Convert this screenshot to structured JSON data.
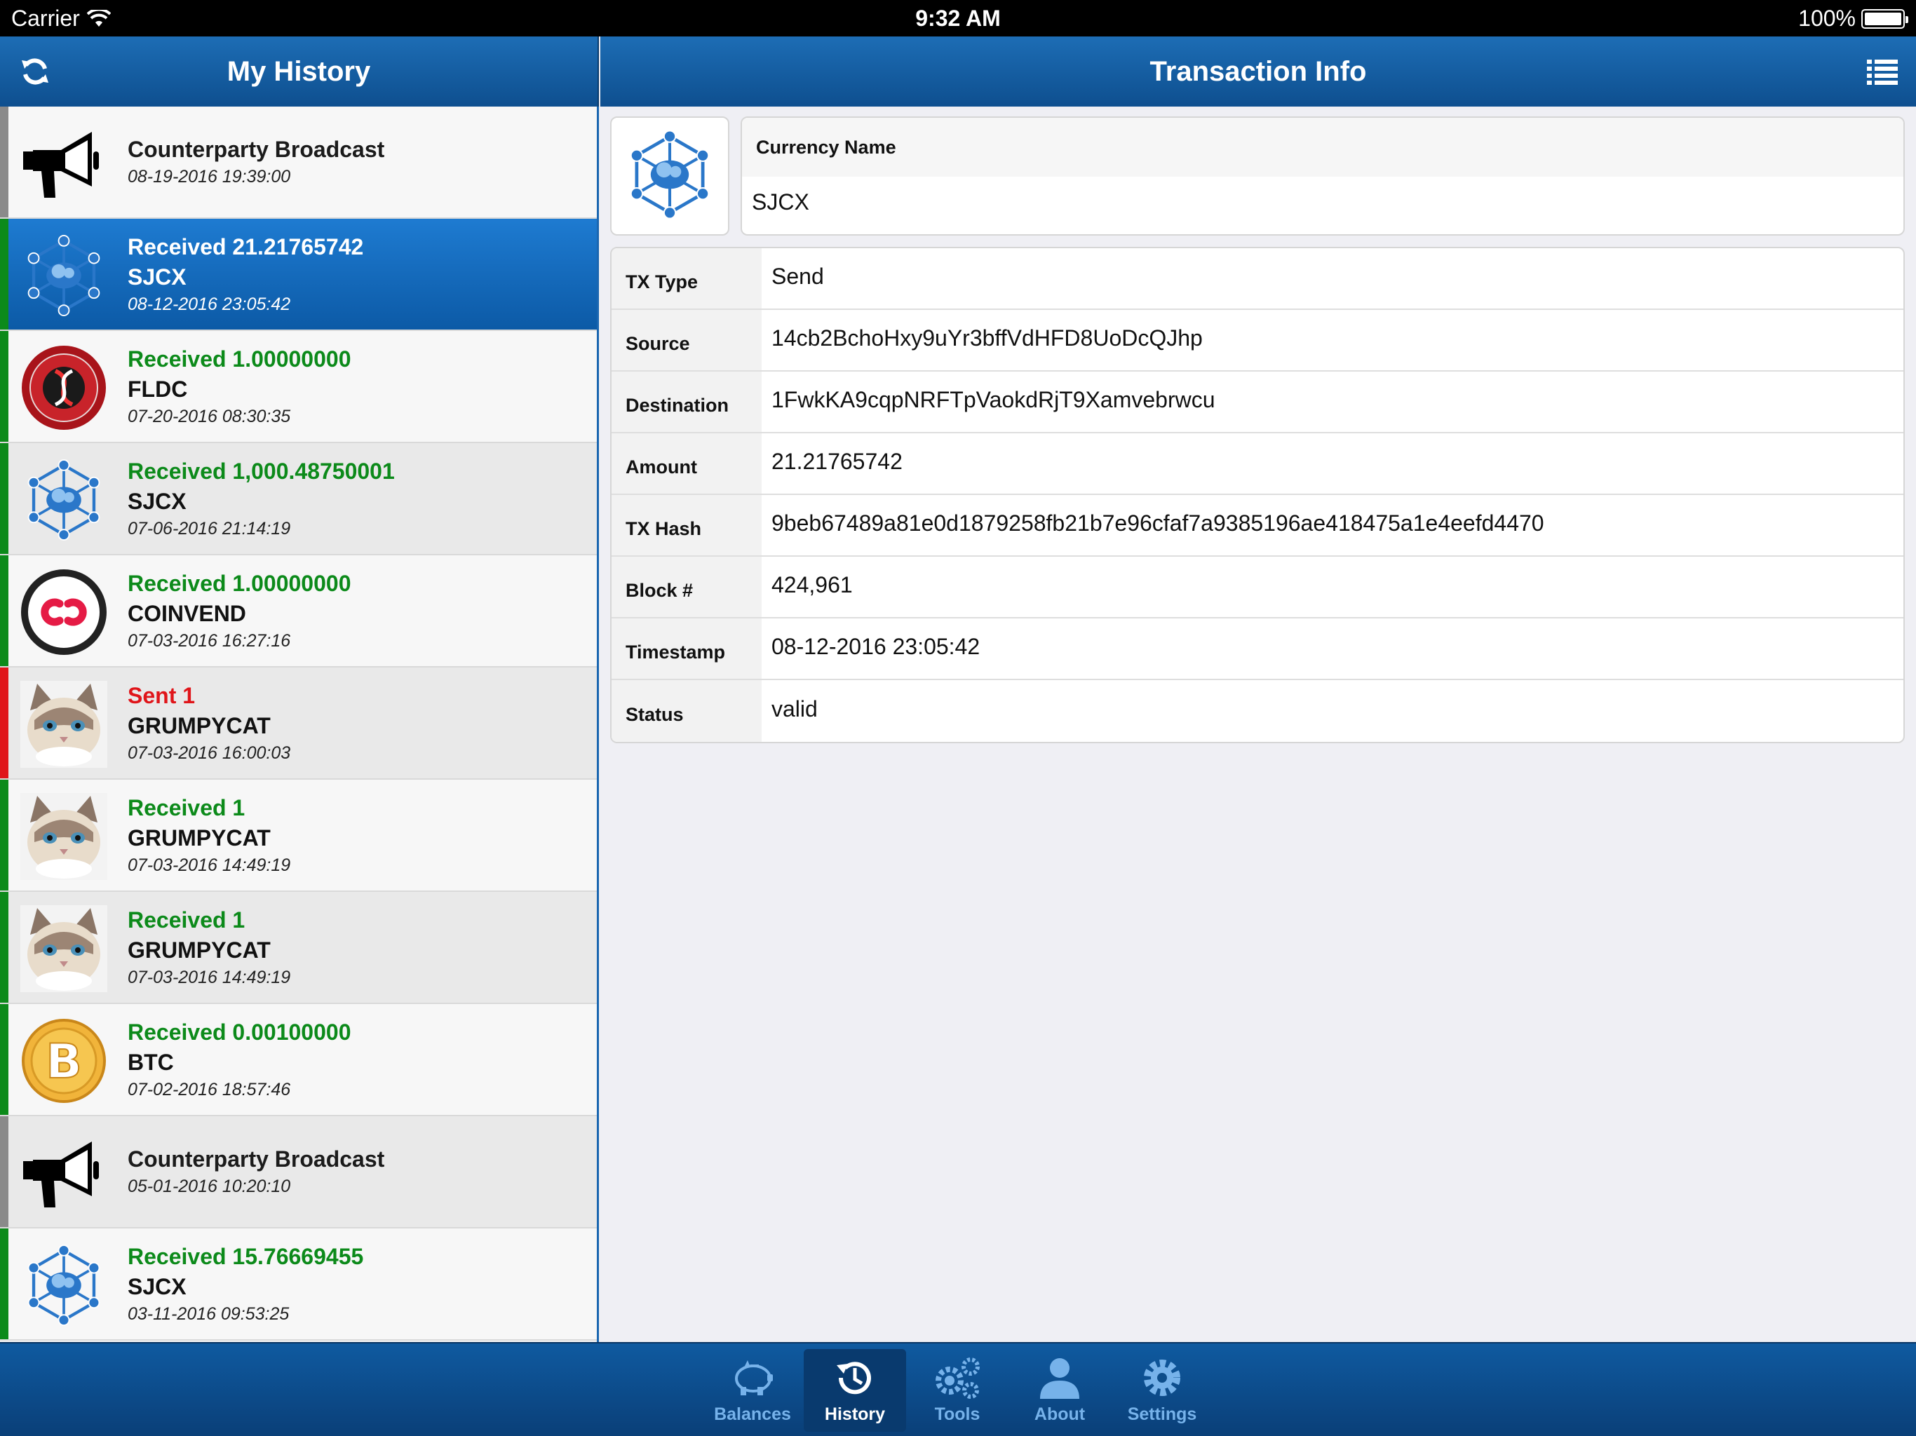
{
  "status_bar": {
    "carrier": "Carrier",
    "time": "9:32 AM",
    "battery": "100%"
  },
  "left_nav": {
    "title": "My History"
  },
  "right_nav": {
    "title": "Transaction Info"
  },
  "colors": {
    "green": "#0c8a1a",
    "red": "#e0151a",
    "gray": "#8a8a8a",
    "accent": "#1a66b0"
  },
  "history": [
    {
      "title": "Counterparty Broadcast",
      "asset": "",
      "date": "08-19-2016 19:39:00",
      "status": "gray",
      "icon": "megaphone-icon"
    },
    {
      "title": "Received 21.21765742",
      "asset": "SJCX",
      "date": "08-12-2016 23:05:42",
      "status": "green",
      "icon": "sjcx-icon",
      "selected": true
    },
    {
      "title": "Received 1.00000000",
      "asset": "FLDC",
      "date": "07-20-2016 08:30:35",
      "status": "green",
      "icon": "fldc-icon"
    },
    {
      "title": "Received 1,000.48750001",
      "asset": "SJCX",
      "date": "07-06-2016 21:14:19",
      "status": "green",
      "icon": "sjcx-icon"
    },
    {
      "title": "Received 1.00000000",
      "asset": "COINVEND",
      "date": "07-03-2016 16:27:16",
      "status": "green",
      "icon": "coinvend-icon"
    },
    {
      "title": "Sent 1",
      "asset": "GRUMPYCAT",
      "date": "07-03-2016 16:00:03",
      "status": "red",
      "icon": "grumpycat-icon"
    },
    {
      "title": "Received 1",
      "asset": "GRUMPYCAT",
      "date": "07-03-2016 14:49:19",
      "status": "green",
      "icon": "grumpycat-icon"
    },
    {
      "title": "Received 1",
      "asset": "GRUMPYCAT",
      "date": "07-03-2016 14:49:19",
      "status": "green",
      "icon": "grumpycat-icon"
    },
    {
      "title": "Received 0.00100000",
      "asset": "BTC",
      "date": "07-02-2016 18:57:46",
      "status": "green",
      "icon": "bitcoin-icon"
    },
    {
      "title": "Counterparty Broadcast",
      "asset": "",
      "date": "05-01-2016 10:20:10",
      "status": "gray",
      "icon": "megaphone-icon"
    },
    {
      "title": "Received 15.76669455",
      "asset": "SJCX",
      "date": "03-11-2016 09:53:25",
      "status": "green",
      "icon": "sjcx-icon"
    }
  ],
  "currency": {
    "label": "Currency Name",
    "value": "SJCX",
    "icon": "sjcx-icon"
  },
  "info": [
    {
      "label": "TX Type",
      "value": "Send"
    },
    {
      "label": "Source",
      "value": "14cb2BchoHxy9uYr3bffVdHFD8UoDcQJhp"
    },
    {
      "label": "Destination",
      "value": "1FwkKA9cqpNRFTpVaokdRjT9Xamvebrwcu"
    },
    {
      "label": "Amount",
      "value": "21.21765742"
    },
    {
      "label": "TX Hash",
      "value": "9beb67489a81e0d1879258fb21b7e96cfaf7a9385196ae418475a1e4eefd4470"
    },
    {
      "label": "Block #",
      "value": "424,961"
    },
    {
      "label": "Timestamp",
      "value": "08-12-2016 23:05:42"
    },
    {
      "label": "Status",
      "value": "valid"
    }
  ],
  "tabs": [
    {
      "label": "Balances",
      "icon": "piggy-bank-icon"
    },
    {
      "label": "History",
      "icon": "history-icon",
      "active": true
    },
    {
      "label": "Tools",
      "icon": "gears-icon"
    },
    {
      "label": "About",
      "icon": "person-icon"
    },
    {
      "label": "Settings",
      "icon": "gear-icon"
    }
  ]
}
